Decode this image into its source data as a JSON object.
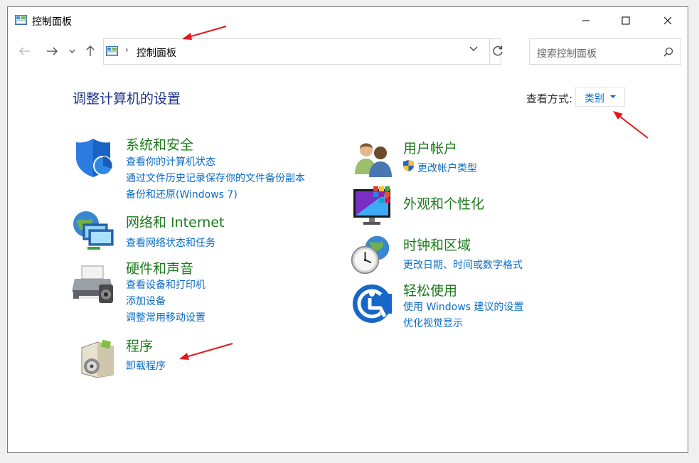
{
  "window": {
    "title": "控制面板",
    "minimize_icon": "minimize-icon",
    "maximize_icon": "maximize-icon",
    "close_icon": "close-icon"
  },
  "address": {
    "path": "控制面板",
    "separator": "›",
    "search_placeholder": "搜索控制面板"
  },
  "main": {
    "heading": "调整计算机的设置",
    "view_by_label": "查看方式:",
    "view_by_value": "类别"
  },
  "categories": [
    {
      "title": "系统和安全",
      "icon": "shield-icon",
      "links": [
        "查看你的计算机状态",
        "通过文件历史记录保存你的文件备份副本",
        "备份和还原(Windows 7)"
      ]
    },
    {
      "title": "网络和 Internet",
      "icon": "network-globe-icon",
      "links": [
        "查看网络状态和任务"
      ]
    },
    {
      "title": "硬件和声音",
      "icon": "printer-icon",
      "links": [
        "查看设备和打印机",
        "添加设备",
        "调整常用移动设置"
      ]
    },
    {
      "title": "程序",
      "icon": "programs-box-icon",
      "links": [
        "卸载程序"
      ]
    },
    {
      "title": "用户帐户",
      "icon": "users-icon",
      "links": [
        "更改帐户类型"
      ]
    },
    {
      "title": "外观和个性化",
      "icon": "monitor-palette-icon",
      "links": []
    },
    {
      "title": "时钟和区域",
      "icon": "clock-globe-icon",
      "links": [
        "更改日期、时间或数字格式"
      ]
    },
    {
      "title": "轻松使用",
      "icon": "ease-of-access-icon",
      "links": [
        "使用 Windows 建议的设置",
        "优化视觉显示"
      ]
    }
  ],
  "colors": {
    "heading": "#1e3287",
    "category_title": "#1c7a1c",
    "link": "#0a6cc6",
    "annotation_arrow": "#e0191c"
  }
}
